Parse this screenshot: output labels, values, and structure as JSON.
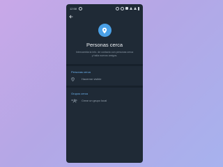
{
  "status_bar": {
    "time": "12:58"
  },
  "screen": {
    "title": "Personas cerca",
    "description": "Intercambia la info. de contacto con personas cerca y halla nuevos amigos."
  },
  "people_section": {
    "header": "Personas cerca",
    "make_visible_label": "Hacerme visible"
  },
  "groups_section": {
    "header": "Grupos cerca",
    "create_group_label": "Crear un grupo local"
  },
  "colors": {
    "screen_background": "#1f2a36",
    "accent": "#4aa0e6",
    "section_header": "#6fb6f2",
    "page_background": "#b4a7e6"
  }
}
